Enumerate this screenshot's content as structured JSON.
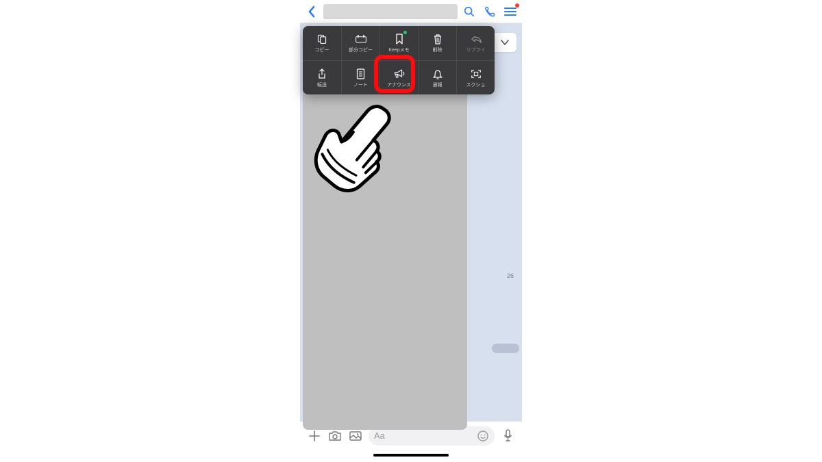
{
  "header": {
    "icons": {
      "back": "chevron-left",
      "search": "search",
      "call": "phone",
      "menu": "hamburger"
    }
  },
  "chat": {
    "timestamp": "26"
  },
  "context_menu": {
    "row1": [
      {
        "label": "コピー",
        "icon": "copy"
      },
      {
        "label": "部分コピー",
        "icon": "partial-copy"
      },
      {
        "label": "Keepメモ",
        "icon": "bookmark",
        "badge": true
      },
      {
        "label": "削除",
        "icon": "trash"
      },
      {
        "label": "リプライ",
        "icon": "reply"
      }
    ],
    "row2": [
      {
        "label": "転送",
        "icon": "share"
      },
      {
        "label": "ノート",
        "icon": "note"
      },
      {
        "label": "アナウンス",
        "icon": "megaphone",
        "highlighted": true
      },
      {
        "label": "通報",
        "icon": "alert"
      },
      {
        "label": "スクショ",
        "icon": "screenshot"
      }
    ]
  },
  "input_bar": {
    "placeholder": "Aa",
    "icons": {
      "plus": "plus",
      "camera": "camera",
      "gallery": "gallery",
      "emoji": "emoji",
      "mic": "mic"
    }
  },
  "colors": {
    "accent_blue": "#2a7cff",
    "highlight_red": "#ff0b0b",
    "menu_bg": "#3a3a3c"
  }
}
